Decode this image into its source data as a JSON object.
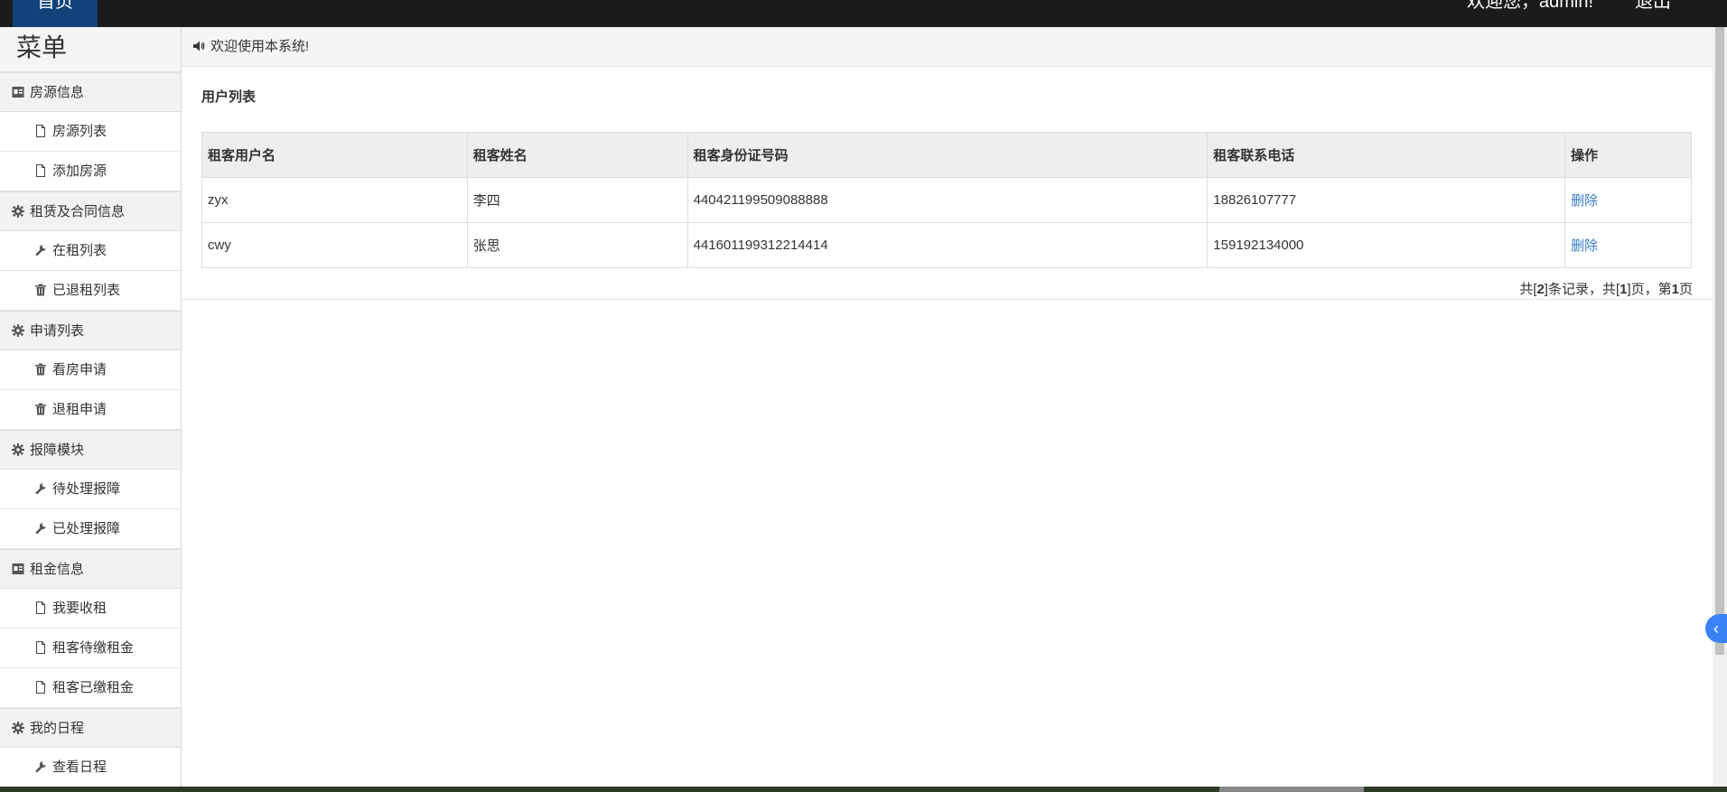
{
  "topbar": {
    "home_label": "首页",
    "welcome_text": "欢迎您，admin!",
    "logout_label": "退出"
  },
  "sidebar": {
    "title": "菜单",
    "groups": [
      {
        "label": "房源信息",
        "icon": "id-card-icon",
        "items": [
          {
            "label": "房源列表",
            "icon": "file-icon"
          },
          {
            "label": "添加房源",
            "icon": "file-icon"
          }
        ]
      },
      {
        "label": "租赁及合同信息",
        "icon": "gear-icon",
        "items": [
          {
            "label": "在租列表",
            "icon": "wrench-icon"
          },
          {
            "label": "已退租列表",
            "icon": "trash-icon"
          }
        ]
      },
      {
        "label": "申请列表",
        "icon": "gear-icon",
        "items": [
          {
            "label": "看房申请",
            "icon": "trash-icon"
          },
          {
            "label": "退租申请",
            "icon": "trash-icon"
          }
        ]
      },
      {
        "label": "报障模块",
        "icon": "gear-icon",
        "items": [
          {
            "label": "待处理报障",
            "icon": "wrench-icon"
          },
          {
            "label": "已处理报障",
            "icon": "wrench-icon"
          }
        ]
      },
      {
        "label": "租金信息",
        "icon": "id-card-icon",
        "items": [
          {
            "label": "我要收租",
            "icon": "file-icon"
          },
          {
            "label": "租客待缴租金",
            "icon": "file-icon"
          },
          {
            "label": "租客已缴租金",
            "icon": "file-icon"
          }
        ]
      },
      {
        "label": "我的日程",
        "icon": "gear-icon",
        "items": [
          {
            "label": "查看日程",
            "icon": "wrench-icon"
          }
        ]
      }
    ]
  },
  "main": {
    "notice": "欢迎使用本系统!",
    "panel_title": "用户列表",
    "table": {
      "headers": [
        "租客用户名",
        "租客姓名",
        "租客身份证号码",
        "租客联系电话",
        "操作"
      ],
      "rows": [
        {
          "username": "zyx",
          "name": "李四",
          "id_number": "440421199509088888",
          "phone": "18826107777",
          "action": "删除"
        },
        {
          "username": "cwy",
          "name": "张思",
          "id_number": "441601199312214414",
          "phone": "159192134000",
          "action": "删除"
        }
      ]
    },
    "pager": {
      "prefix": "共[",
      "total_records": "2",
      "records_suffix": "]条记录，共[",
      "total_pages": "1",
      "pages_suffix": "]页，第",
      "current_page": "1",
      "page_suffix": "页"
    }
  },
  "colors": {
    "topbar": "#1b1b1b",
    "home_button": "#12427a",
    "link": "#3a7dc9",
    "toggle": "#3b82f6"
  }
}
